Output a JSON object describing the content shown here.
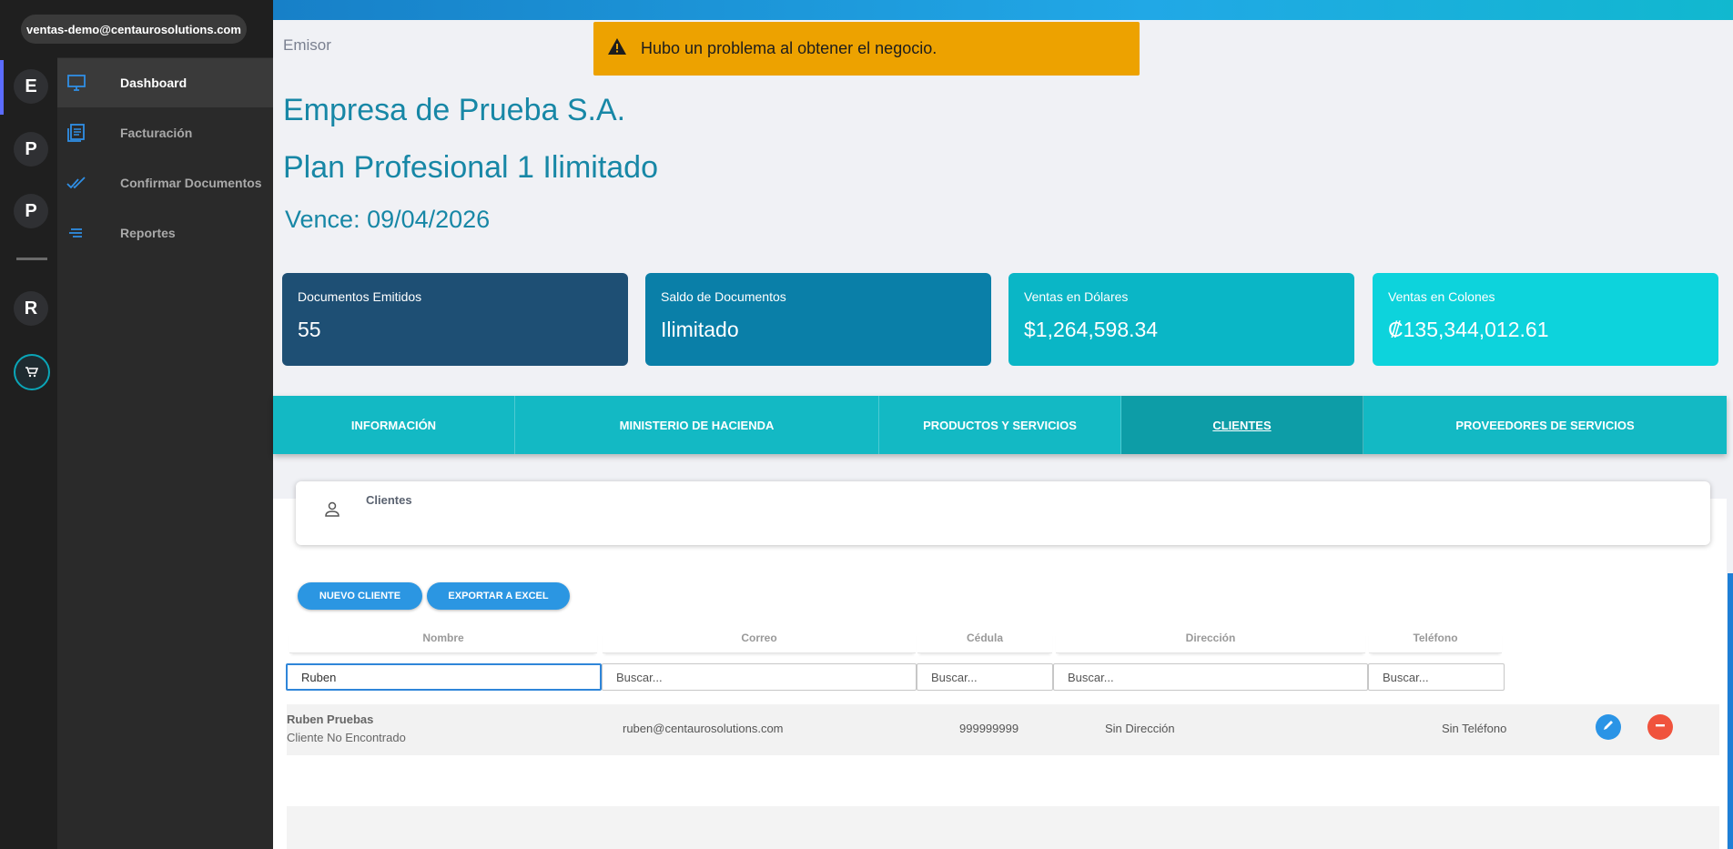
{
  "user": {
    "email": "ventas-demo@centaurosolutions.com"
  },
  "rail": {
    "items": [
      "E",
      "P",
      "P",
      "R"
    ],
    "cart_icon": "cart-icon"
  },
  "nav": {
    "items": [
      {
        "label": "Dashboard",
        "icon": "monitor-icon",
        "active": true
      },
      {
        "label": "Facturación",
        "icon": "invoice-icon",
        "active": false
      },
      {
        "label": "Confirmar Documentos",
        "icon": "double-check-icon",
        "active": false
      },
      {
        "label": "Reportes",
        "icon": "lines-icon",
        "active": false
      }
    ]
  },
  "header": {
    "emisor": "Emisor",
    "alert": "Hubo un problema al obtener el negocio.",
    "company": "Empresa de Prueba S.A.",
    "plan": "Plan Profesional 1 Ilimitado",
    "expires": "Vence: 09/04/2026"
  },
  "cards": [
    {
      "title": "Documentos Emitidos",
      "value": "55",
      "color": "#1e4f74"
    },
    {
      "title": "Saldo de Documentos",
      "value": "Ilimitado",
      "color": "#0a7fa8"
    },
    {
      "title": "Ventas en Dólares",
      "value": "$1,264,598.34",
      "color": "#0ab6c6"
    },
    {
      "title": "Ventas en Colones",
      "value": "₡135,344,012.61",
      "color": "#0dd3dc"
    }
  ],
  "tabs": [
    {
      "label": "INFORMACIÓN",
      "active": false
    },
    {
      "label": "MINISTERIO DE HACIENDA",
      "active": false
    },
    {
      "label": "PRODUCTOS Y SERVICIOS",
      "active": false
    },
    {
      "label": "CLIENTES",
      "active": true
    },
    {
      "label": "PROVEEDORES DE SERVICIOS",
      "active": false
    }
  ],
  "clients_section": {
    "title": "Clientes"
  },
  "buttons": {
    "new_client": "NUEVO CLIENTE",
    "export_excel": "EXPORTAR A EXCEL"
  },
  "table": {
    "columns": [
      "Nombre",
      "Correo",
      "Cédula",
      "Dirección",
      "Teléfono"
    ],
    "filters": {
      "nombre": "Ruben",
      "placeholder": "Buscar..."
    },
    "rows": [
      {
        "name": "Ruben Pruebas",
        "status": "Cliente No Encontrado",
        "email": "ruben@centaurosolutions.com",
        "cedula": "999999999",
        "direccion": "Sin Dirección",
        "telefono": "Sin Teléfono"
      }
    ]
  },
  "colors": {
    "accent": "#13b9c4",
    "primary_button": "#2b96e2",
    "alert": "#eda200",
    "delete": "#f0533d",
    "edit": "#2a94e6"
  }
}
